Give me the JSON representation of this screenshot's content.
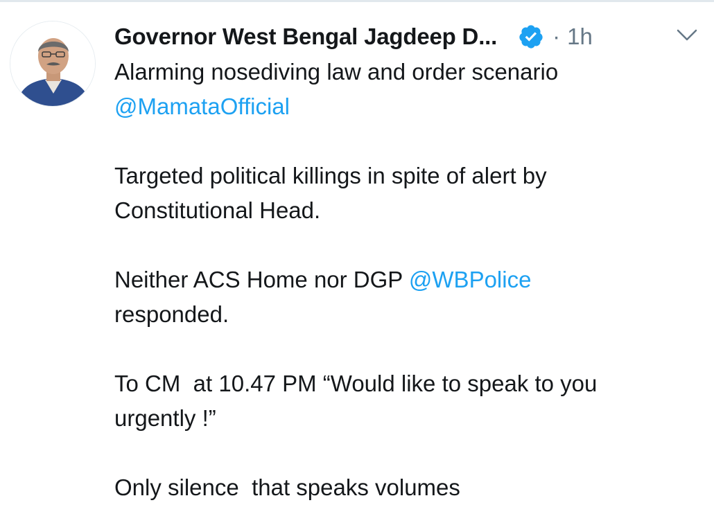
{
  "author": {
    "display_name": "Governor West Bengal Jagdeep D...",
    "verified": true,
    "timestamp": "1h",
    "separator": "·"
  },
  "tweet": {
    "line1": "Alarming nosediving law and order scenario",
    "mention1": "@MamataOfficial",
    "line3": "Targeted political killings in spite of alert by",
    "line4": "Constitutional Head.",
    "line5_prefix": "Neither ACS Home nor DGP ",
    "mention2": "@WBPolice",
    "line6": "responded.",
    "line7": "To CM  at 10.47 PM “Would like to speak to you",
    "line8": "urgently !”",
    "line9": "Only silence  that speaks volumes"
  },
  "colors": {
    "link": "#1da1f2",
    "text": "#14171a",
    "muted": "#657786",
    "verified_badge": "#1da1f2"
  },
  "icons": {
    "verified": "verified-badge-icon",
    "menu": "chevron-down-icon"
  }
}
